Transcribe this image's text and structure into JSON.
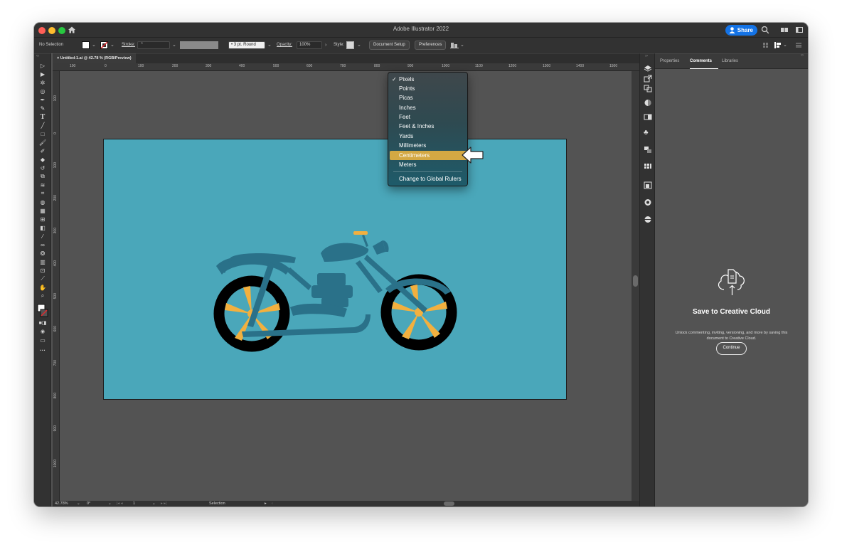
{
  "window": {
    "title": "Adobe Illustrator 2022",
    "share_label": "Share"
  },
  "control_bar": {
    "selection_label": "No Selection",
    "stroke_label": "Stroke:",
    "brush_label": "3 pt. Round",
    "opacity_label": "Opacity:",
    "opacity_value": "100%",
    "style_label": "Style:",
    "document_setup": "Document Setup",
    "preferences": "Preferences"
  },
  "document_tab": {
    "label": "Untitled-1.ai @ 42.78 % (RGB/Preview)"
  },
  "rulers": {
    "top": [
      "100",
      "0",
      "100",
      "200",
      "300",
      "400",
      "500",
      "600",
      "700",
      "800",
      "900",
      "1000",
      "1100",
      "1200",
      "1300",
      "1400",
      "1500"
    ],
    "left": [
      "100",
      "0",
      "100",
      "200",
      "300",
      "400",
      "500",
      "600",
      "700",
      "800",
      "900",
      "1000"
    ]
  },
  "ruler_units_menu": {
    "items": [
      {
        "label": "Pixels",
        "checked": true
      },
      {
        "label": "Points"
      },
      {
        "label": "Picas"
      },
      {
        "label": "Inches"
      },
      {
        "label": "Feet"
      },
      {
        "label": "Feet & Inches"
      },
      {
        "label": "Yards"
      },
      {
        "label": "Millimeters"
      },
      {
        "label": "Centimeters",
        "highlighted": true
      },
      {
        "label": "Meters"
      }
    ],
    "global_rulers": "Change to Global Rulers",
    "check_mark": "✓",
    "highlight_color": "#d4a843"
  },
  "status_bar": {
    "zoom": "42.78%",
    "rotation": "0°",
    "artboard_number": "1",
    "tool": "Selection"
  },
  "panel": {
    "tabs": [
      "Properties",
      "Comments",
      "Libraries"
    ],
    "active_tab": "Comments",
    "cloud_title": "Save to Creative Cloud",
    "cloud_description": "Unlock commenting, inviting, versioning, and more by saving this document to Creative Cloud.",
    "continue_label": "Continue"
  },
  "colors": {
    "artboard": "#4aa7ba",
    "motorcycle_body": "#2a7189",
    "wheel_spokes": "#f2b03f",
    "tires": "#000000",
    "accent": "#1473e6"
  }
}
